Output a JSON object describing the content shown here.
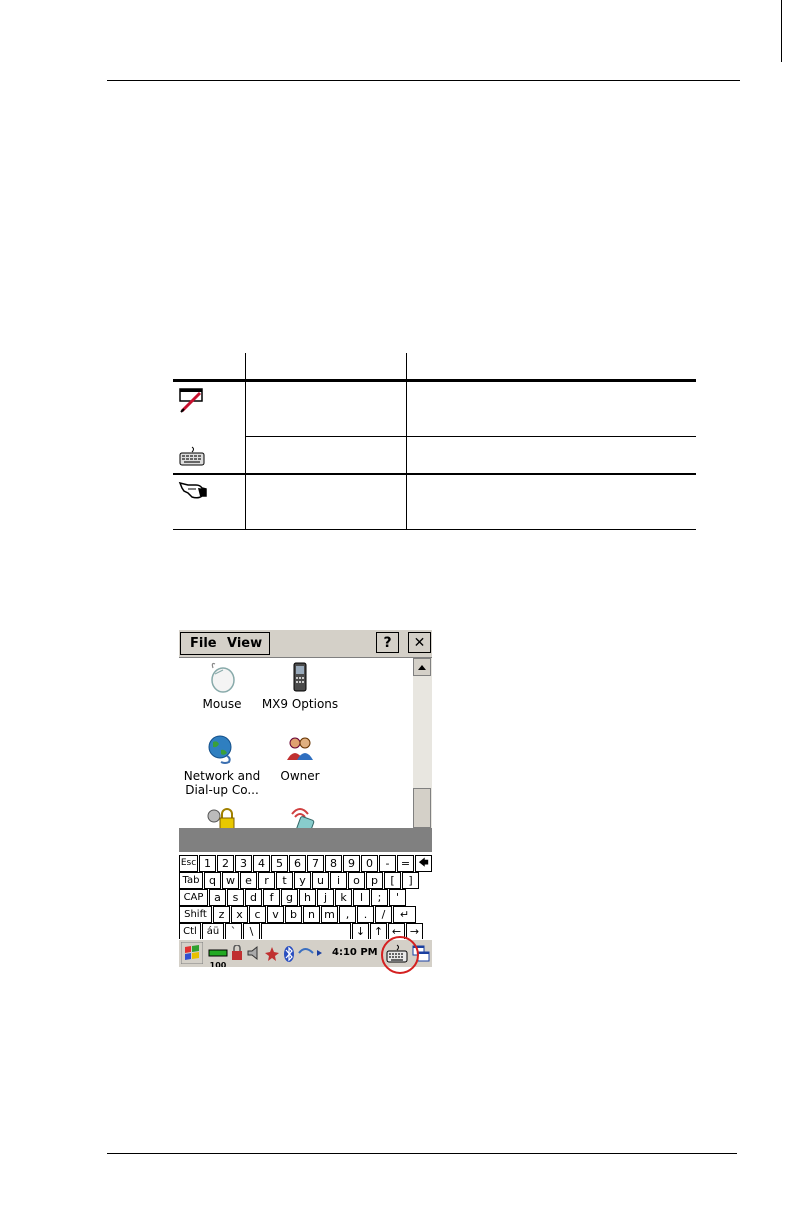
{
  "document": {
    "header_rule": true,
    "footer_rule": true
  },
  "table": {
    "rows": [
      {
        "icon": "pen-input-icon",
        "col2": "",
        "col3": ""
      },
      {
        "icon": "keyboard-icon",
        "col2": "",
        "col3": ""
      },
      {
        "icon": "hand-pointer-icon",
        "col2": "",
        "col3": ""
      }
    ]
  },
  "screen": {
    "menu": {
      "file": "File",
      "view": "View",
      "help_button": "?",
      "close_button": "✕"
    },
    "items": [
      {
        "label": "Mouse",
        "icon": "mouse-icon"
      },
      {
        "label": "MX9 Options",
        "icon": "mobile-device-icon"
      },
      {
        "label": "Network and",
        "label2": "Dial-up Co...",
        "icon": "network-globe-icon"
      },
      {
        "label": "Owner",
        "icon": "owner-people-icon"
      },
      {
        "label": "",
        "icon": "password-lock-icon"
      },
      {
        "label": "",
        "icon": "power-device-icon"
      }
    ],
    "keyboard": {
      "row1": [
        "Esc",
        "1",
        "2",
        "3",
        "4",
        "5",
        "6",
        "7",
        "8",
        "9",
        "0",
        "-",
        "=",
        "🡄"
      ],
      "row2": [
        "Tab",
        "q",
        "w",
        "e",
        "r",
        "t",
        "y",
        "u",
        "i",
        "o",
        "p",
        "[",
        "]"
      ],
      "row3": [
        "CAP",
        "a",
        "s",
        "d",
        "f",
        "g",
        "h",
        "j",
        "k",
        "l",
        ";",
        "'"
      ],
      "row4": [
        "Shift",
        "z",
        "x",
        "c",
        "v",
        "b",
        "n",
        "m",
        ",",
        ".",
        "/",
        "↵"
      ],
      "row5": [
        "Ctl",
        "áü",
        "`",
        "\\",
        "",
        "↓",
        "↑",
        "←",
        "→"
      ]
    },
    "taskbar": {
      "battery": "100",
      "time": "4:10 PM",
      "highlighted": "keyboard-icon"
    }
  },
  "colors": {
    "highlight_circle": "#d42020",
    "chrome": "#d4d0c8"
  }
}
